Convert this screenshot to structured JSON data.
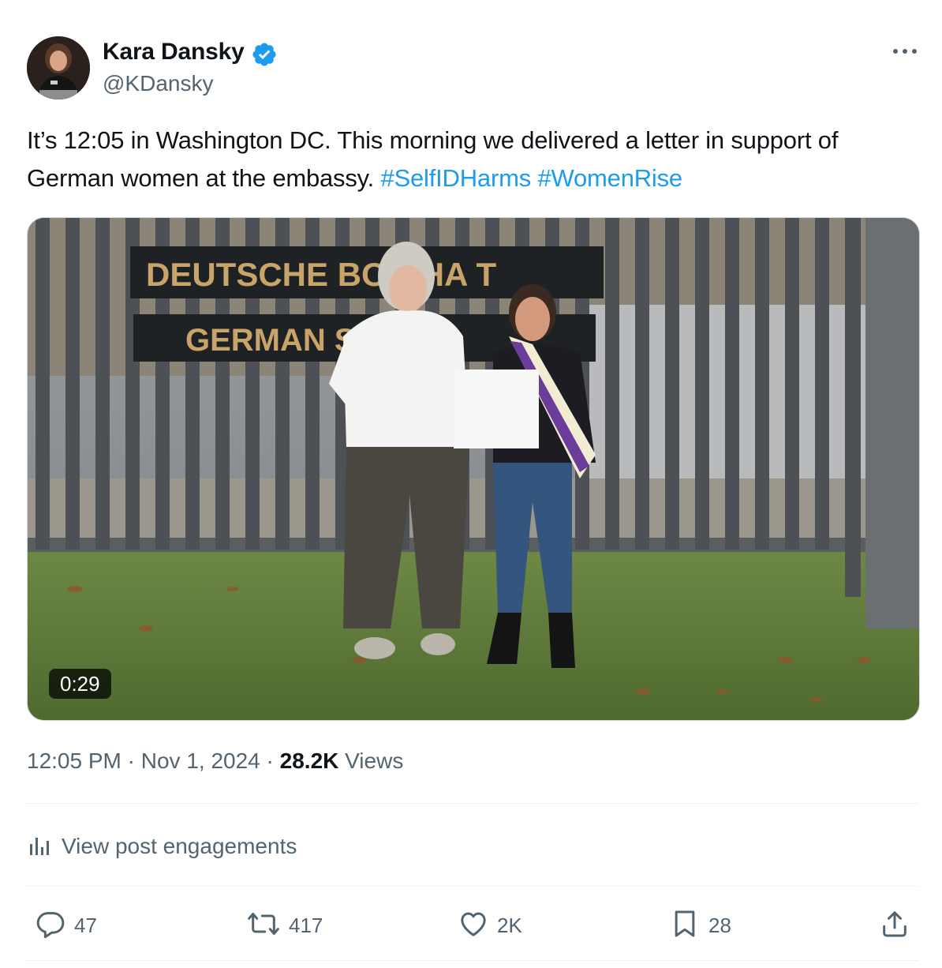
{
  "author": {
    "display_name": "Kara Dansky",
    "handle": "@KDansky",
    "verified": true,
    "avatar_icon": "avatar-photo"
  },
  "tweet": {
    "text": "It’s 12:05 in Washington DC. This morning we delivered a letter in support of German women at the embassy. ",
    "hashtags": [
      "#SelfIDHarms",
      "#WomenRise"
    ]
  },
  "media": {
    "type": "video",
    "duration": "0:29",
    "sign_line_1": "DEUTSCHE BO   CHA  T",
    "sign_line_2": "GERMAN   SS"
  },
  "meta": {
    "time": "12:05 PM",
    "separator": "·",
    "date": "Nov 1, 2024",
    "views_count": "28.2K",
    "views_label": "Views"
  },
  "engagements_label": "View post engagements",
  "actions": {
    "replies": "47",
    "reposts": "417",
    "likes": "2K",
    "bookmarks": "28"
  },
  "colors": {
    "accent": "#1d9bf0",
    "secondary_text": "#536471",
    "primary_text": "#0f1419"
  },
  "icons": {
    "verified": "verified-badge-icon",
    "more": "more-dots-icon",
    "engagements": "bar-chart-icon",
    "reply": "reply-bubble-icon",
    "repost": "repost-arrows-icon",
    "like": "heart-icon",
    "bookmark": "bookmark-icon",
    "share": "share-upload-icon"
  }
}
